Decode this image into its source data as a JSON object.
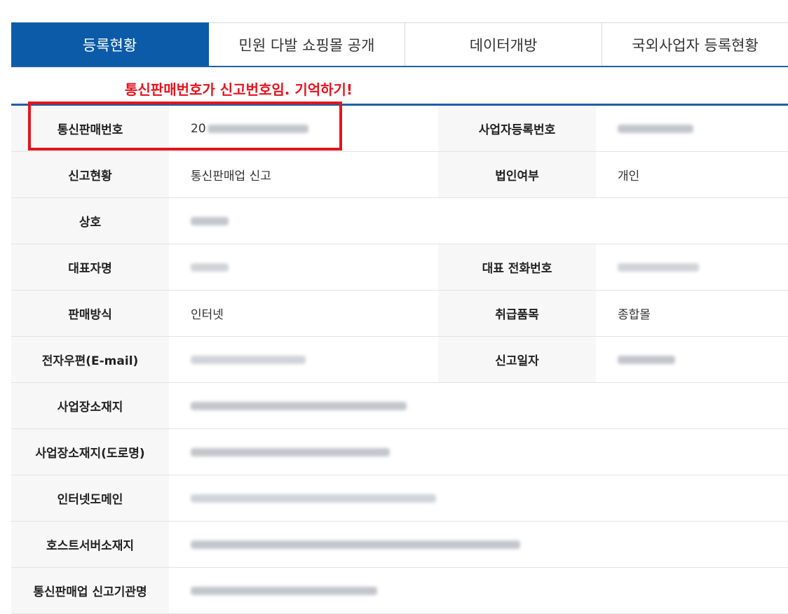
{
  "tabs": [
    {
      "label": "등록현황",
      "active": true
    },
    {
      "label": "민원 다발 쇼핑몰 공개",
      "active": false
    },
    {
      "label": "데이터개방",
      "active": false
    },
    {
      "label": "국외사업자 등록현황",
      "active": false
    }
  ],
  "annotation": {
    "note": "통신판매번호가 신고번호임. 기억하기!",
    "color": "#e8121e"
  },
  "table": {
    "rows": [
      {
        "label1": "통신판매번호",
        "value1_prefix": "20",
        "label2": "사업자등록번호"
      },
      {
        "label1": "신고현황",
        "value1": "통신판매업 신고",
        "label2": "법인여부",
        "value2": "개인"
      },
      {
        "label1": "상호"
      },
      {
        "label1": "대표자명",
        "label2": "대표 전화번호"
      },
      {
        "label1": "판매방식",
        "value1": "인터넷",
        "label2": "취급품목",
        "value2": "종합몰"
      },
      {
        "label1": "전자우편(E-mail)",
        "label2": "신고일자"
      },
      {
        "label1": "사업장소재지"
      },
      {
        "label1": "사업장소재지(도로명)"
      },
      {
        "label1": "인터넷도메인"
      },
      {
        "label1": "호스트서버소재지"
      },
      {
        "label1": "통신판매업 신고기관명"
      }
    ]
  },
  "colors": {
    "accent": "#0b5ba8",
    "table_border": "#1f5ea8",
    "header_bg": "#f7f7f7"
  }
}
